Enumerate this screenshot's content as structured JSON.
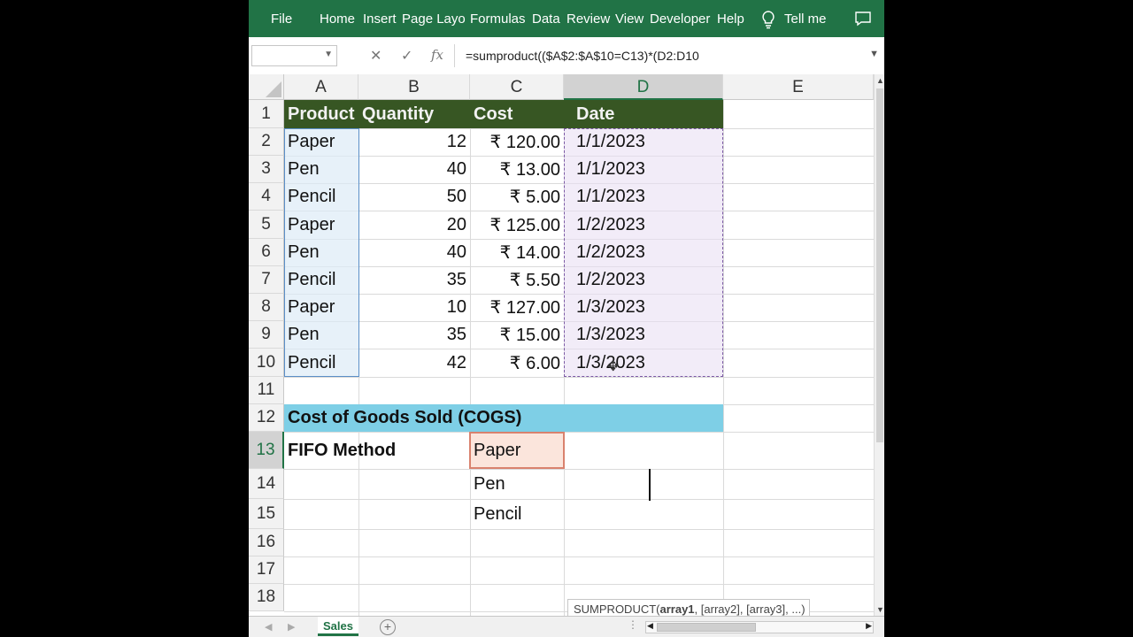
{
  "ribbon": {
    "tabs": [
      "File",
      "Home",
      "Insert",
      "Page Layout",
      "Formulas",
      "Data",
      "Review",
      "View",
      "Developer",
      "Help"
    ],
    "tell_me": "Tell me",
    "bg_color": "#217346"
  },
  "formula_bar": {
    "name_box": "",
    "cancel_icon": "✕",
    "enter_icon": "✓",
    "fx_icon": "fx",
    "formula": "=sumproduct(($A$2:$A$10=C13)*(D2:D10"
  },
  "columns": [
    "A",
    "B",
    "C",
    "D",
    "E"
  ],
  "rows": [
    "1",
    "2",
    "3",
    "4",
    "5",
    "6",
    "7",
    "8",
    "9",
    "10",
    "11",
    "12",
    "13",
    "14",
    "15",
    "16",
    "17",
    "18"
  ],
  "header_row": {
    "product": "Product",
    "quantity": "Quantity",
    "cost": "Cost",
    "date": "Date",
    "fill_color": "#375623"
  },
  "table": [
    {
      "product": "Paper",
      "quantity": "12",
      "cost": "₹ 120.00",
      "date": "1/1/2023"
    },
    {
      "product": "Pen",
      "quantity": "40",
      "cost": "₹ 13.00",
      "date": "1/1/2023"
    },
    {
      "product": "Pencil",
      "quantity": "50",
      "cost": "₹ 5.00",
      "date": "1/1/2023"
    },
    {
      "product": "Paper",
      "quantity": "20",
      "cost": "₹ 125.00",
      "date": "1/2/2023"
    },
    {
      "product": "Pen",
      "quantity": "40",
      "cost": "₹ 14.00",
      "date": "1/2/2023"
    },
    {
      "product": "Pencil",
      "quantity": "35",
      "cost": "₹ 5.50",
      "date": "1/2/2023"
    },
    {
      "product": "Paper",
      "quantity": "10",
      "cost": "₹ 127.00",
      "date": "1/3/2023"
    },
    {
      "product": "Pen",
      "quantity": "35",
      "cost": "₹ 15.00",
      "date": "1/3/2023"
    },
    {
      "product": "Pencil",
      "quantity": "42",
      "cost": "₹ 6.00",
      "date": "1/3/2023"
    }
  ],
  "cogs": {
    "title": "Cost of Goods Sold (COGS)",
    "band_color": "#7ecfe6",
    "method_label": "FIFO Method",
    "products": [
      "Paper",
      "Pen",
      "Pencil"
    ]
  },
  "tooltip": {
    "fn": "SUMPRODUCT(",
    "arg1": "array1",
    "rest": ", [array2], [array3], ...)"
  },
  "sheets": {
    "active": "Sales",
    "add_icon": "+"
  }
}
